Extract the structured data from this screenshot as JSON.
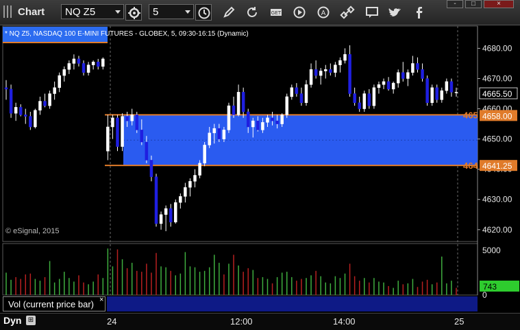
{
  "toolbar": {
    "title": "Chart",
    "symbol": "NQ Z5",
    "interval": "5",
    "icons": [
      "timer-icon",
      "pencil-icon",
      "refresh-icon",
      "get-icon",
      "play-icon",
      "alert-icon",
      "link-icon",
      "chat-icon",
      "twitter-icon",
      "facebook-icon"
    ]
  },
  "window": {
    "minimize": "-",
    "maximize": "□",
    "close": "×"
  },
  "chart_title": "* NQ Z5, NASDAQ 100 E-MINI FUTURES - GLOBEX, 5, 09:30-16:15 (Dynamic)",
  "copyright": "© eSignal, 2015",
  "volume_panel": {
    "label": "Vol (current price bar)",
    "close": "×",
    "last_value": "743"
  },
  "footer": {
    "mode": "Dyn",
    "lock_glyph": "⊞"
  },
  "colors": {
    "up": "#ffffff",
    "down": "#1f1fe0",
    "zone": "#2a5bf0",
    "zone_line": "#e07b2a",
    "vol_up": "#3fae3f",
    "vol_down": "#b82020",
    "last_tag": "#2ecc2e"
  },
  "chart_data": {
    "type": "candlestick",
    "yaxis": {
      "ticks": [
        "4680.00",
        "4670.00",
        "4660.00",
        "4650.00",
        "4640.00",
        "4630.00",
        "4620.00"
      ],
      "range": [
        4617,
        4686
      ]
    },
    "xaxis": {
      "ticks": [
        "24",
        "12:00",
        "14:00",
        "25"
      ]
    },
    "price_tags": {
      "last": "4665.50",
      "upper": "4658.00",
      "lower": "4641.25",
      "upper_left_label": "465",
      "lower_left_label": "464"
    },
    "zone": {
      "top": 4658.0,
      "bottom": 4641.25
    },
    "volume_ticks": [
      "5000",
      "0"
    ],
    "candles": [
      [
        4667.0,
        4669.5,
        4663.0,
        4666.5
      ],
      [
        4666.5,
        4668.0,
        4657.0,
        4658.5
      ],
      [
        4658.5,
        4662.0,
        4656.0,
        4660.5
      ],
      [
        4660.5,
        4661.5,
        4657.5,
        4658.0
      ],
      [
        4658.0,
        4660.0,
        4655.0,
        4657.5
      ],
      [
        4657.5,
        4659.0,
        4653.0,
        4654.0
      ],
      [
        4654.0,
        4660.0,
        4653.5,
        4659.5
      ],
      [
        4659.5,
        4664.0,
        4658.0,
        4662.5
      ],
      [
        4662.5,
        4665.0,
        4660.5,
        4661.0
      ],
      [
        4661.0,
        4666.0,
        4660.0,
        4665.0
      ],
      [
        4665.0,
        4669.0,
        4663.0,
        4667.0
      ],
      [
        4667.0,
        4672.0,
        4665.5,
        4671.0
      ],
      [
        4671.0,
        4674.0,
        4669.0,
        4673.0
      ],
      [
        4673.0,
        4676.0,
        4671.5,
        4675.0
      ],
      [
        4675.0,
        4678.0,
        4673.0,
        4676.5
      ],
      [
        4676.5,
        4677.5,
        4674.0,
        4675.0
      ],
      [
        4675.0,
        4676.0,
        4671.0,
        4672.0
      ],
      [
        4672.0,
        4675.5,
        4671.0,
        4674.5
      ],
      [
        4674.5,
        4676.0,
        4673.0,
        4675.5
      ],
      [
        4675.5,
        4676.5,
        4673.0,
        4674.0
      ],
      [
        4674.0,
        4677.0,
        4673.0,
        4676.5
      ],
      [
        4646.0,
        4658.0,
        4643.0,
        4654.0
      ],
      [
        4654.0,
        4658.0,
        4650.0,
        4657.0
      ],
      [
        4657.0,
        4658.0,
        4646.0,
        4647.5
      ],
      [
        4647.5,
        4658.5,
        4646.0,
        4657.5
      ],
      [
        4657.5,
        4659.0,
        4654.0,
        4656.0
      ],
      [
        4656.0,
        4660.0,
        4654.5,
        4658.0
      ],
      [
        4658.0,
        4659.0,
        4652.0,
        4653.0
      ],
      [
        4653.0,
        4656.5,
        4648.0,
        4649.0
      ],
      [
        4649.0,
        4651.0,
        4642.0,
        4643.0
      ],
      [
        4643.0,
        4644.5,
        4636.0,
        4637.5
      ],
      [
        4637.5,
        4638.5,
        4621.0,
        4622.0
      ],
      [
        4622.0,
        4626.0,
        4620.0,
        4625.0
      ],
      [
        4625.0,
        4628.0,
        4619.5,
        4627.0
      ],
      [
        4627.0,
        4628.5,
        4621.0,
        4622.5
      ],
      [
        4622.5,
        4630.0,
        4622.0,
        4629.0
      ],
      [
        4629.0,
        4632.0,
        4627.0,
        4631.0
      ],
      [
        4631.0,
        4635.5,
        4629.0,
        4634.0
      ],
      [
        4634.0,
        4637.0,
        4631.0,
        4636.0
      ],
      [
        4636.0,
        4640.0,
        4634.0,
        4638.0
      ],
      [
        4638.0,
        4643.0,
        4637.0,
        4642.0
      ],
      [
        4642.0,
        4649.0,
        4641.0,
        4648.0
      ],
      [
        4648.0,
        4654.0,
        4647.0,
        4652.0
      ],
      [
        4652.0,
        4655.0,
        4648.5,
        4653.5
      ],
      [
        4653.5,
        4655.0,
        4649.0,
        4650.0
      ],
      [
        4650.0,
        4654.0,
        4649.0,
        4653.0
      ],
      [
        4653.0,
        4662.0,
        4652.0,
        4661.0
      ],
      [
        4661.0,
        4664.0,
        4657.0,
        4658.0
      ],
      [
        4658.0,
        4668.0,
        4657.5,
        4665.5
      ],
      [
        4665.5,
        4667.0,
        4657.0,
        4659.0
      ],
      [
        4659.0,
        4660.0,
        4652.0,
        4654.0
      ],
      [
        4654.0,
        4657.0,
        4650.5,
        4656.0
      ],
      [
        4656.0,
        4657.5,
        4652.5,
        4653.0
      ],
      [
        4653.0,
        4657.0,
        4652.0,
        4655.5
      ],
      [
        4655.5,
        4658.0,
        4654.0,
        4657.0
      ],
      [
        4657.0,
        4659.0,
        4654.5,
        4656.0
      ],
      [
        4656.0,
        4658.0,
        4653.5,
        4655.0
      ],
      [
        4655.0,
        4658.5,
        4654.0,
        4658.0
      ],
      [
        4658.0,
        4665.0,
        4657.0,
        4664.0
      ],
      [
        4664.0,
        4668.0,
        4663.0,
        4667.0
      ],
      [
        4667.0,
        4668.5,
        4664.0,
        4665.0
      ],
      [
        4665.0,
        4667.0,
        4661.0,
        4662.0
      ],
      [
        4662.0,
        4669.5,
        4661.0,
        4668.0
      ],
      [
        4668.0,
        4675.0,
        4667.0,
        4673.0
      ],
      [
        4673.0,
        4676.0,
        4670.0,
        4671.0
      ],
      [
        4671.0,
        4673.5,
        4668.0,
        4672.5
      ],
      [
        4672.5,
        4674.5,
        4670.0,
        4673.0
      ],
      [
        4673.0,
        4675.0,
        4671.0,
        4672.0
      ],
      [
        4672.0,
        4675.5,
        4670.5,
        4674.5
      ],
      [
        4674.5,
        4677.0,
        4672.0,
        4676.0
      ],
      [
        4676.0,
        4680.0,
        4675.0,
        4678.0
      ],
      [
        4678.0,
        4681.0,
        4664.0,
        4665.0
      ],
      [
        4665.0,
        4667.0,
        4661.0,
        4662.0
      ],
      [
        4662.0,
        4664.0,
        4659.0,
        4660.0
      ],
      [
        4660.0,
        4666.0,
        4659.0,
        4665.0
      ],
      [
        4665.0,
        4666.5,
        4660.0,
        4661.0
      ],
      [
        4661.0,
        4668.0,
        4660.0,
        4667.0
      ],
      [
        4667.0,
        4669.0,
        4665.0,
        4668.0
      ],
      [
        4668.0,
        4670.0,
        4666.5,
        4669.0
      ],
      [
        4669.0,
        4670.5,
        4666.0,
        4666.5
      ],
      [
        4666.5,
        4669.0,
        4665.0,
        4668.5
      ],
      [
        4668.5,
        4673.0,
        4667.0,
        4672.0
      ],
      [
        4672.0,
        4675.5,
        4669.0,
        4670.0
      ],
      [
        4670.0,
        4673.0,
        4667.5,
        4672.0
      ],
      [
        4672.0,
        4677.5,
        4671.0,
        4675.0
      ],
      [
        4675.0,
        4677.0,
        4672.0,
        4673.0
      ],
      [
        4673.0,
        4675.0,
        4669.0,
        4670.0
      ],
      [
        4670.0,
        4671.0,
        4661.0,
        4662.0
      ],
      [
        4662.0,
        4668.0,
        4661.0,
        4667.0
      ],
      [
        4667.0,
        4668.0,
        4662.0,
        4663.0
      ],
      [
        4663.0,
        4667.0,
        4662.0,
        4666.0
      ],
      [
        4666.0,
        4670.0,
        4665.0,
        4669.0
      ],
      [
        4669.0,
        4670.0,
        4664.0,
        4665.5
      ],
      [
        4665.5,
        4667.0,
        4664.0,
        4665.5
      ]
    ],
    "volume": [
      [
        2500,
        1
      ],
      [
        1700,
        1
      ],
      [
        2000,
        0
      ],
      [
        1800,
        0
      ],
      [
        2300,
        0
      ],
      [
        2400,
        0
      ],
      [
        1800,
        1
      ],
      [
        1600,
        1
      ],
      [
        2000,
        0
      ],
      [
        3800,
        1
      ],
      [
        1400,
        1
      ],
      [
        1800,
        1
      ],
      [
        2600,
        1
      ],
      [
        1900,
        1
      ],
      [
        1500,
        1
      ],
      [
        2200,
        0
      ],
      [
        1400,
        0
      ],
      [
        1200,
        1
      ],
      [
        1500,
        1
      ],
      [
        2300,
        0
      ],
      [
        1900,
        1
      ],
      [
        5200,
        1
      ],
      [
        3200,
        1
      ],
      [
        5100,
        0
      ],
      [
        4000,
        1
      ],
      [
        3000,
        0
      ],
      [
        3600,
        1
      ],
      [
        2700,
        0
      ],
      [
        2600,
        0
      ],
      [
        3500,
        0
      ],
      [
        2500,
        0
      ],
      [
        4700,
        0
      ],
      [
        3200,
        1
      ],
      [
        3100,
        1
      ],
      [
        2700,
        0
      ],
      [
        2200,
        1
      ],
      [
        2400,
        1
      ],
      [
        4800,
        1
      ],
      [
        3200,
        1
      ],
      [
        3100,
        1
      ],
      [
        2600,
        1
      ],
      [
        2700,
        1
      ],
      [
        3100,
        1
      ],
      [
        4500,
        1
      ],
      [
        3600,
        1
      ],
      [
        2300,
        0
      ],
      [
        3500,
        1
      ],
      [
        4500,
        0
      ],
      [
        3300,
        1
      ],
      [
        2600,
        0
      ],
      [
        3000,
        0
      ],
      [
        2800,
        1
      ],
      [
        1900,
        0
      ],
      [
        2000,
        1
      ],
      [
        1800,
        1
      ],
      [
        1300,
        0
      ],
      [
        2000,
        1
      ],
      [
        2500,
        1
      ],
      [
        2600,
        1
      ],
      [
        2000,
        1
      ],
      [
        1600,
        0
      ],
      [
        1800,
        0
      ],
      [
        1900,
        1
      ],
      [
        2200,
        1
      ],
      [
        2700,
        0
      ],
      [
        2100,
        1
      ],
      [
        1400,
        1
      ],
      [
        1300,
        1
      ],
      [
        2100,
        1
      ],
      [
        1900,
        1
      ],
      [
        2400,
        1
      ],
      [
        3500,
        0
      ],
      [
        2100,
        0
      ],
      [
        1600,
        0
      ],
      [
        1900,
        1
      ],
      [
        1400,
        0
      ],
      [
        1900,
        1
      ],
      [
        1500,
        1
      ],
      [
        1400,
        1
      ],
      [
        1000,
        0
      ],
      [
        800,
        1
      ],
      [
        1600,
        1
      ],
      [
        1200,
        0
      ],
      [
        1300,
        1
      ],
      [
        1800,
        1
      ],
      [
        900,
        0
      ],
      [
        1500,
        0
      ],
      [
        1700,
        0
      ],
      [
        1200,
        1
      ],
      [
        1400,
        0
      ],
      [
        4300,
        1
      ],
      [
        1300,
        1
      ],
      [
        1600,
        1
      ],
      [
        800,
        0
      ]
    ]
  }
}
